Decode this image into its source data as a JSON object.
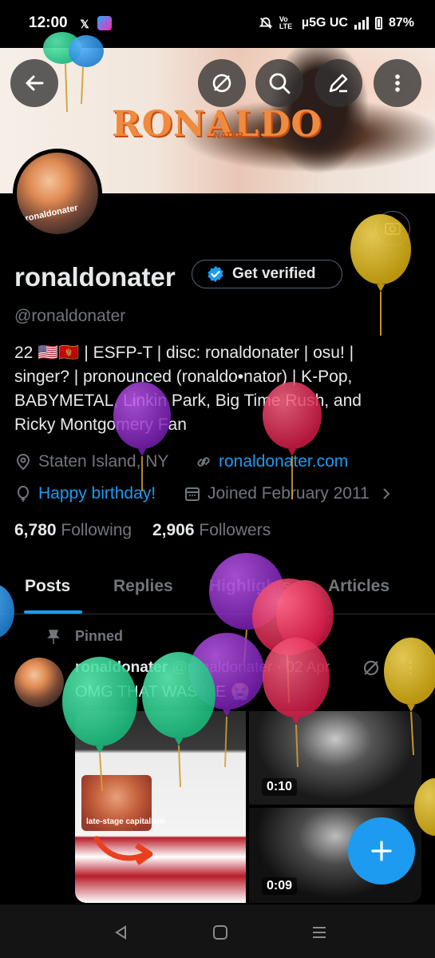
{
  "status_bar": {
    "time": "12:00",
    "network": "µ5G UC",
    "battery": "87%",
    "volte": "Vo LTE",
    "icons": [
      "x-icon",
      "app-icon",
      "mute-icon",
      "volte-icon",
      "signal-icon",
      "battery-icon"
    ]
  },
  "banner": {
    "logo_text": "RONALDO",
    "logo_sub": "NATER"
  },
  "profile": {
    "display_name": "ronaldonater",
    "verified_label": "Get verified",
    "handle": "@ronaldonater",
    "bio_lines": [
      "22 🇺🇸🇲🇪 | ESFP-T | disc: ronaldonater | osu! |",
      "singer? | pronounced (ronaldo•nator) | K-Pop,",
      "BABYMETAL, Linkin Park, Big Time Rush, and",
      "Ricky Montgomery Fan"
    ],
    "location": "Staten Island, NY",
    "website": "ronaldonater.com",
    "birthday": "Happy birthday!",
    "joined": "Joined February 2011",
    "following_count": "6,780",
    "following_label": "Following",
    "followers_count": "2,906",
    "followers_label": "Followers",
    "avatar_text": "ronaldonater"
  },
  "tabs": [
    {
      "label": "Posts",
      "active": true
    },
    {
      "label": "Replies",
      "active": false
    },
    {
      "label": "Highlights",
      "active": false
    },
    {
      "label": "Articles",
      "active": false
    }
  ],
  "post": {
    "pinned_label": "Pinned",
    "author": "ronaldonater",
    "handle": "@ronaldonater",
    "separator": "·",
    "date": "02 Apr",
    "text": "OMG THAT WAS ME 😭",
    "media": [
      {
        "type": "image",
        "caption": "late-stage capitalism"
      },
      {
        "type": "video",
        "duration": "0:10"
      },
      {
        "type": "video",
        "duration": "0:09"
      }
    ]
  },
  "colors": {
    "accent": "#1d9bf0",
    "text": "#e7e9ea",
    "muted": "#71767b",
    "background": "#000000"
  }
}
